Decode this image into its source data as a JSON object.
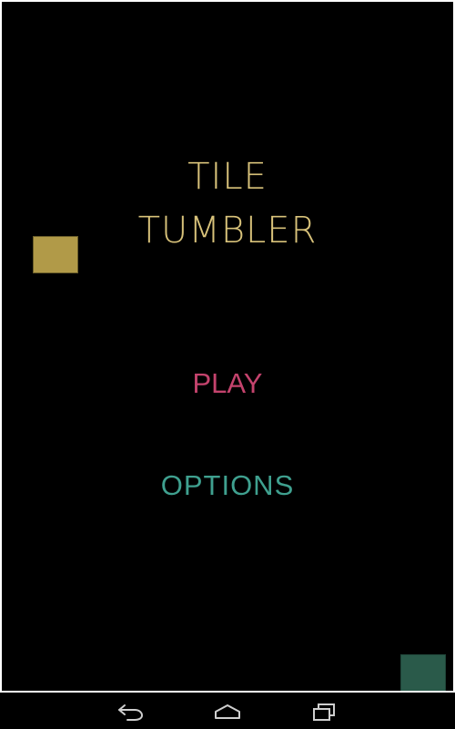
{
  "game": {
    "title_line_1": "TILE",
    "title_line_2": "TUMBLER",
    "play_label": "PLAY",
    "options_label": "OPTIONS"
  },
  "colors": {
    "background": "#000000",
    "title": "#d8c27a",
    "play": "#c4436d",
    "options": "#3fa08f",
    "tile_gold": "#b19a48",
    "tile_teal": "#2a5a4a",
    "nav_icon": "#cfcfcf"
  },
  "navbar": {
    "icons": [
      "back-icon",
      "home-icon",
      "recents-icon"
    ]
  }
}
